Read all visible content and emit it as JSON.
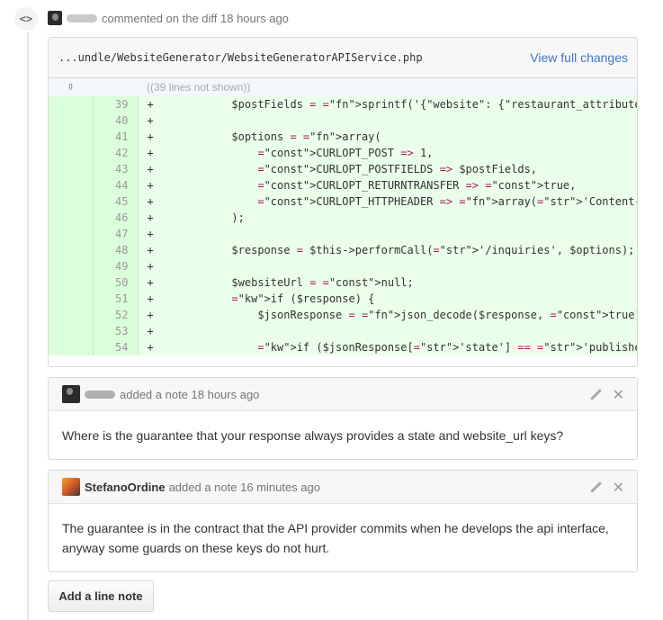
{
  "event": {
    "icon": "code-icon",
    "icon_glyph": "<>",
    "action_text": "commented on the diff 18 hours ago"
  },
  "diff": {
    "path": "...undle/WebsiteGenerator/WebsiteGeneratorAPIService.php",
    "view_full_label": "View full changes",
    "hunk_text": "((39 lines not shown))",
    "expand_icon": "unfold-icon",
    "lines": [
      {
        "num": "39",
        "sign": "+",
        "code": "        $postFields = sprintf('{\"website\": {\"restaurant_attributes\": {\"lafe"
      },
      {
        "num": "40",
        "sign": "+",
        "code": ""
      },
      {
        "num": "41",
        "sign": "+",
        "code": "        $options = array("
      },
      {
        "num": "42",
        "sign": "+",
        "code": "            CURLOPT_POST => 1,"
      },
      {
        "num": "43",
        "sign": "+",
        "code": "            CURLOPT_POSTFIELDS => $postFields,"
      },
      {
        "num": "44",
        "sign": "+",
        "code": "            CURLOPT_RETURNTRANSFER => true,"
      },
      {
        "num": "45",
        "sign": "+",
        "code": "            CURLOPT_HTTPHEADER => array('Content-type: application/json'),"
      },
      {
        "num": "46",
        "sign": "+",
        "code": "        );"
      },
      {
        "num": "47",
        "sign": "+",
        "code": ""
      },
      {
        "num": "48",
        "sign": "+",
        "code": "        $response = $this->performCall('/inquiries', $options);"
      },
      {
        "num": "49",
        "sign": "+",
        "code": ""
      },
      {
        "num": "50",
        "sign": "+",
        "code": "        $websiteUrl = null;"
      },
      {
        "num": "51",
        "sign": "+",
        "code": "        if ($response) {"
      },
      {
        "num": "52",
        "sign": "+",
        "code": "            $jsonResponse = json_decode($response, true);"
      },
      {
        "num": "53",
        "sign": "+",
        "code": ""
      },
      {
        "num": "54",
        "sign": "+",
        "code": "            if ($jsonResponse['state'] == 'published') {"
      }
    ]
  },
  "notes": [
    {
      "author": "",
      "meta": "added a note 18 hours ago",
      "body": "Where is the guarantee that your response always provides a state and website_url keys?"
    },
    {
      "author": "StefanoOrdine",
      "meta": "added a note 16 minutes ago",
      "body": "The guarantee is in the contract that the API provider commits when he develops the api interface, anyway some guards on these keys do not hurt."
    }
  ],
  "actions": {
    "edit_icon": "pencil-icon",
    "close_icon": "close-icon",
    "close_glyph": "✕"
  },
  "add_line_note_label": "Add a line note",
  "colors": {
    "link": "#4078c0",
    "addition_bg": "#eaffea",
    "addition_num_bg": "#dbffdb"
  }
}
